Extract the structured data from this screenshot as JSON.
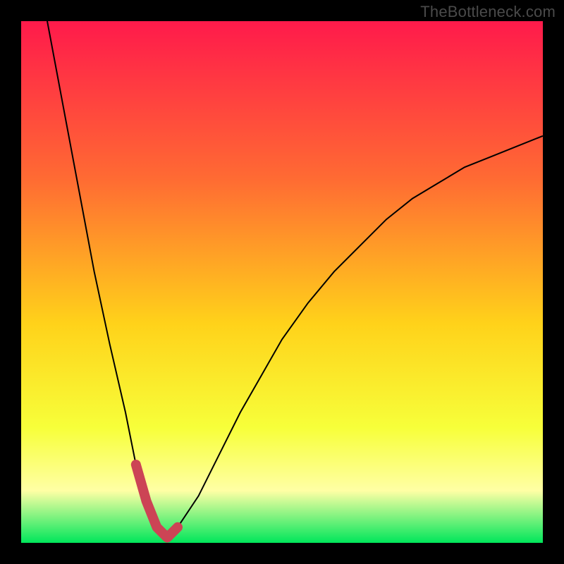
{
  "watermark": "TheBottleneck.com",
  "gradient": {
    "top": "#ff1a4b",
    "q1": "#ff6a33",
    "mid": "#ffd21a",
    "q3": "#f7ff3a",
    "band": "#ffffa5",
    "bottom": "#00e65b"
  },
  "curve_color": "#000000",
  "marker_color": "#cc4455",
  "chart_data": {
    "type": "line",
    "title": "",
    "xlabel": "",
    "ylabel": "",
    "xlim": [
      0,
      100
    ],
    "ylim": [
      0,
      100
    ],
    "series": [
      {
        "name": "bottleneck-curve",
        "x": [
          5,
          8,
          11,
          14,
          17,
          20,
          22,
          24,
          26,
          28,
          30,
          34,
          38,
          42,
          46,
          50,
          55,
          60,
          65,
          70,
          75,
          80,
          85,
          90,
          95,
          100
        ],
        "values": [
          100,
          84,
          68,
          52,
          38,
          25,
          15,
          8,
          3,
          1,
          3,
          9,
          17,
          25,
          32,
          39,
          46,
          52,
          57,
          62,
          66,
          69,
          72,
          74,
          76,
          78
        ]
      }
    ],
    "markers": {
      "name": "highlight-region",
      "x": [
        22,
        24,
        26,
        28,
        30
      ],
      "values": [
        15,
        8,
        3,
        1,
        3
      ]
    }
  }
}
